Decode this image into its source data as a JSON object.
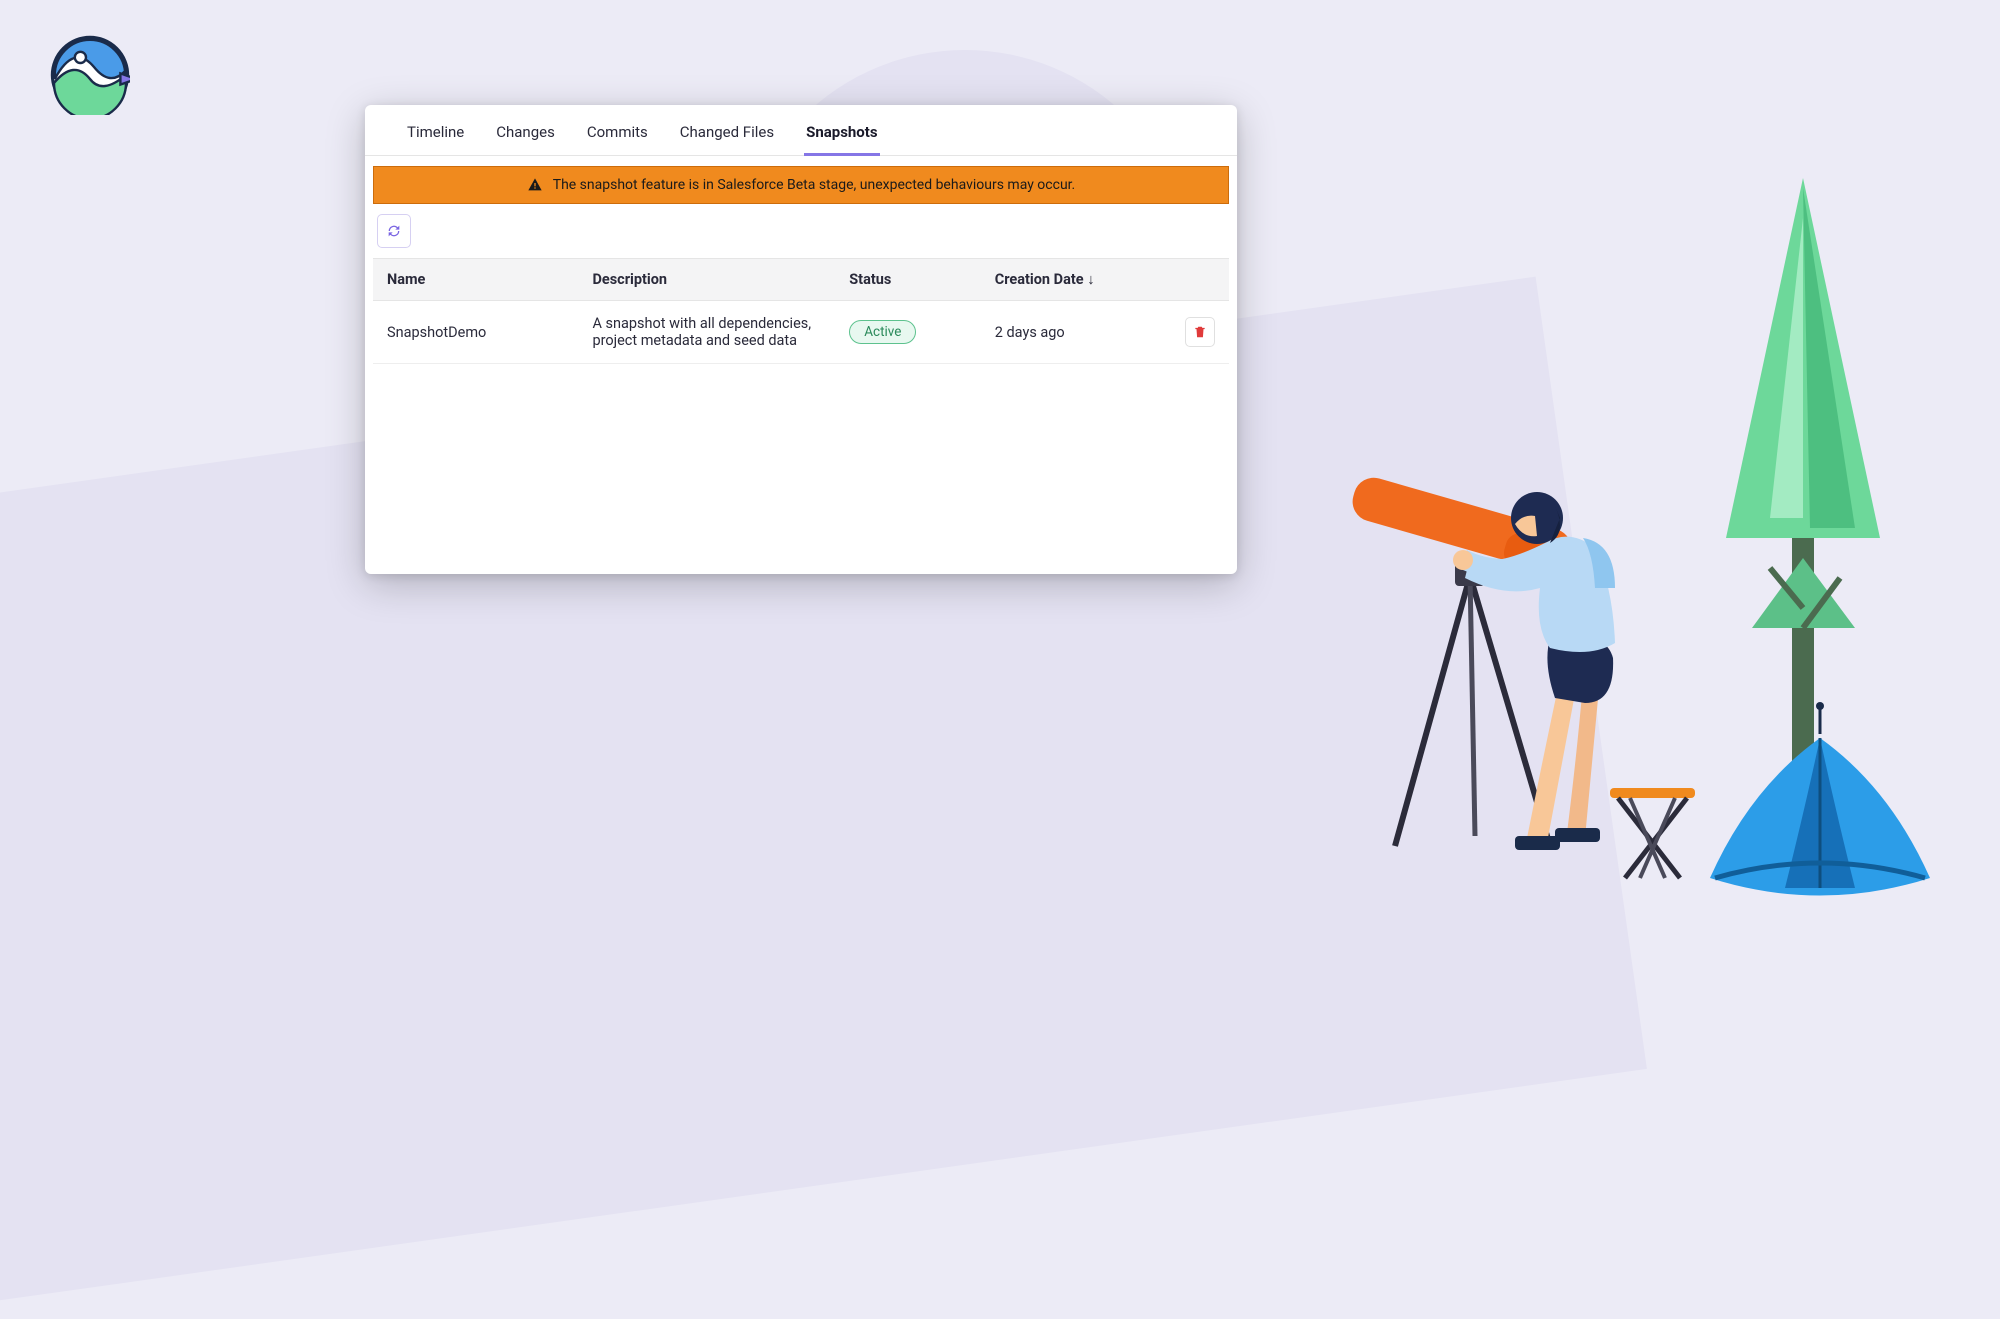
{
  "tabs": {
    "items": [
      {
        "label": "Timeline",
        "active": false
      },
      {
        "label": "Changes",
        "active": false
      },
      {
        "label": "Commits",
        "active": false
      },
      {
        "label": "Changed Files",
        "active": false
      },
      {
        "label": "Snapshots",
        "active": true
      }
    ]
  },
  "banner": {
    "text": "The snapshot feature is in Salesforce Beta stage, unexpected behaviours may occur."
  },
  "table": {
    "headers": {
      "name": "Name",
      "description": "Description",
      "status": "Status",
      "creation_date": "Creation Date",
      "sort_indicator": "↓"
    },
    "rows": [
      {
        "name": "SnapshotDemo",
        "description": "A snapshot with all dependencies, project metadata and seed data",
        "status": "Active",
        "creation_date": "2 days ago"
      }
    ]
  }
}
